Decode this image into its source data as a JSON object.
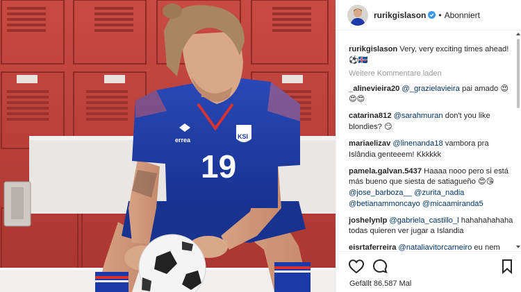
{
  "post": {
    "username": "rurikgislason",
    "separator": "•",
    "follow_state": "Abonniert",
    "verified_icon": "verified-badge-icon",
    "jersey_number": "19",
    "crest_text": "KSI",
    "brand_text": "errea"
  },
  "caption": {
    "author": "rurikgislason",
    "text": "Very, very exciting times ahead! ⚽🇮🇸"
  },
  "load_more": "Weitere Kommentare laden",
  "comments": [
    {
      "author": "_alinevieira20",
      "mention": "@_grazielavieira",
      "text": " pai amado 😍😍😍"
    },
    {
      "author": "catarina812",
      "mention": "@sarahmuran",
      "text": " don't you like blondies? 😏"
    },
    {
      "author": "mariaelizav",
      "mention": "@linenanda18",
      "text": " vambora pra Islândia genteeem! Kkkkkk"
    },
    {
      "author": "pamela.galvan.5437",
      "text": "Haaaa nooo pero si está más bueno que siesta de satiagueño 😍😘 ",
      "mentions": [
        "@jose_barboza__",
        "@zurita_nadia",
        "@betianammoncayo",
        "@micaamiranda5"
      ]
    },
    {
      "author": "joshelynlp",
      "mention": "@gabriela_castillo_l",
      "text": " hahahahahaha todas quieren ver jugar a Islandia"
    },
    {
      "author": "eisrtaferreira",
      "mention": "@nataliavitorcarneiro",
      "text": " eu nem queria seguir ele mesmo 😂😂😂"
    }
  ],
  "actions": {
    "like_icon": "heart-icon",
    "comment_icon": "comment-bubble-icon",
    "save_icon": "bookmark-icon"
  },
  "likes_text": "Gefällt 86.587 Mal",
  "colors": {
    "mention": "#003569",
    "muted": "#999999",
    "verified": "#3897f0",
    "jersey_blue": "#1b3aa8",
    "locker_red": "#c0423c"
  }
}
